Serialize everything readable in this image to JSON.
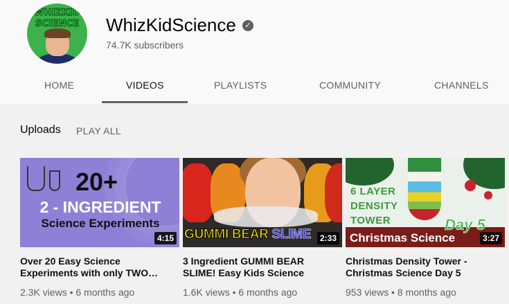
{
  "channel": {
    "name": "WhizKidScience",
    "subscribers": "74.7K subscribers",
    "logo_line1": "WHIZKID",
    "logo_line2": "SCIENCE",
    "verified_glyph": "✓"
  },
  "tabs": [
    {
      "label": "HOME",
      "active": false
    },
    {
      "label": "VIDEOS",
      "active": true
    },
    {
      "label": "PLAYLISTS",
      "active": false
    },
    {
      "label": "COMMUNITY",
      "active": false
    },
    {
      "label": "CHANNELS",
      "active": false
    }
  ],
  "section": {
    "title": "Uploads",
    "play_all": "PLAY ALL"
  },
  "videos": [
    {
      "title": "Over 20 Easy Science Experiments with only TWO…",
      "meta": "2.3K views • 6 months ago",
      "duration": "4:15",
      "thumb_text": [
        "20+",
        "2 - INGREDIENT",
        "Science Experiments"
      ]
    },
    {
      "title": "3 Ingredient GUMMI BEAR SLIME! Easy Kids Science",
      "meta": "1.6K views • 6 months ago",
      "duration": "2:33",
      "thumb_text": [
        "GUMMI BEAR",
        "SLIME"
      ]
    },
    {
      "title": "Christmas Density Tower - Christmas Science Day 5",
      "meta": "953 views • 8 months ago",
      "duration": "3:27",
      "thumb_text": [
        "6 LAYER",
        "DENSITY",
        "TOWER",
        "Day 5",
        "Christmas Science"
      ]
    }
  ],
  "colors": {
    "text_primary": "#0f0f0f",
    "text_secondary": "#606060",
    "header_bg": "#f9f9f9",
    "content_bg": "#f1f1f1"
  }
}
